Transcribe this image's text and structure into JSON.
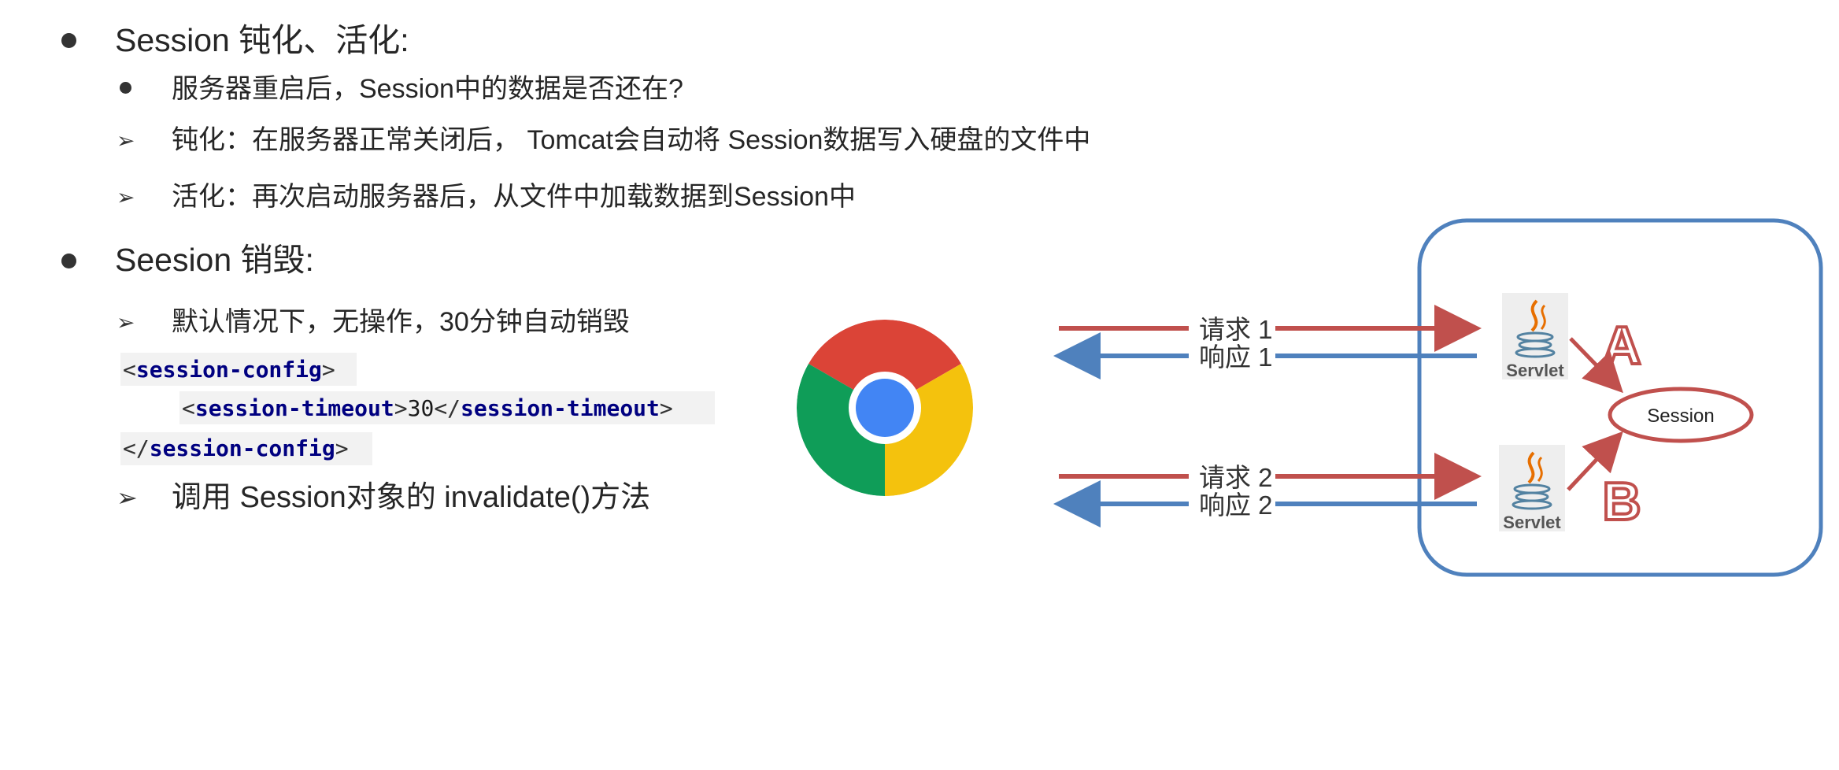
{
  "section1": {
    "heading": "Session 钝化、活化:",
    "question": "服务器重启后，Session中的数据是否还在?",
    "passivation": "钝化：在服务器正常关闭后， Tomcat会自动将 Session数据写入硬盘的文件中",
    "activation": "活化：再次启动服务器后，从文件中加载数据到Session中"
  },
  "section2": {
    "heading": "Seesion 销毁:",
    "default_timeout": "默认情况下，无操作，30分钟自动销毁",
    "code": {
      "open_tag": "session-config",
      "inner_tag": "session-timeout",
      "inner_value": "30",
      "close_tag": "session-config"
    },
    "invalidate": "调用 Session对象的 invalidate()方法"
  },
  "diagram": {
    "request1": "请求 1",
    "response1": "响应 1",
    "request2": "请求 2",
    "response2": "响应 2",
    "servlet_a_label": "Servlet",
    "servlet_b_label": "Servlet",
    "letter_a": "A",
    "letter_b": "B",
    "session_label": "Session",
    "colors": {
      "request_arrow": "#c0504d",
      "response_arrow": "#4f81bd",
      "container_border": "#4f81bd",
      "letter": "#c0504d"
    },
    "icons": [
      "chrome-browser-icon",
      "java-servlet-icon"
    ]
  }
}
